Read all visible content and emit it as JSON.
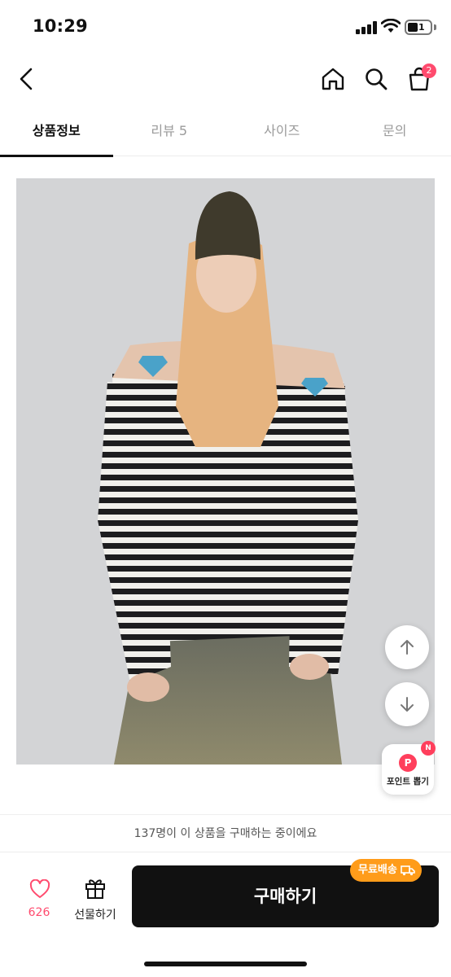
{
  "status_bar": {
    "time": "10:29",
    "battery": "11",
    "icons": [
      "signal-icon",
      "wifi-icon",
      "battery-icon"
    ]
  },
  "nav": {
    "icons": [
      "back-arrow-icon",
      "home-icon",
      "search-icon",
      "shopping-bag-icon"
    ],
    "cart_count": "2"
  },
  "tabs": [
    {
      "label": "상품정보",
      "active": true
    },
    {
      "label": "리뷰 5",
      "active": false
    },
    {
      "label": "사이즈",
      "active": false
    },
    {
      "label": "문의",
      "active": false
    }
  ],
  "floating": {
    "icons": [
      "arrow-up-icon",
      "arrow-down-icon"
    ],
    "point_badge": "P",
    "point_label": "포인트 뽑기",
    "new_badge": "N"
  },
  "notice": "137명이 이 상품을 구매하는 중이에요",
  "bottom": {
    "like_count": "626",
    "gift_label": "선물하기",
    "buy_label": "구매하기",
    "free_shipping": "무료배송",
    "icons": [
      "heart-icon",
      "gift-icon",
      "truck-icon"
    ]
  },
  "colors": {
    "accent": "#ff4b6e",
    "shipping_badge": "#ff9c1a",
    "buy_button": "#111111"
  }
}
